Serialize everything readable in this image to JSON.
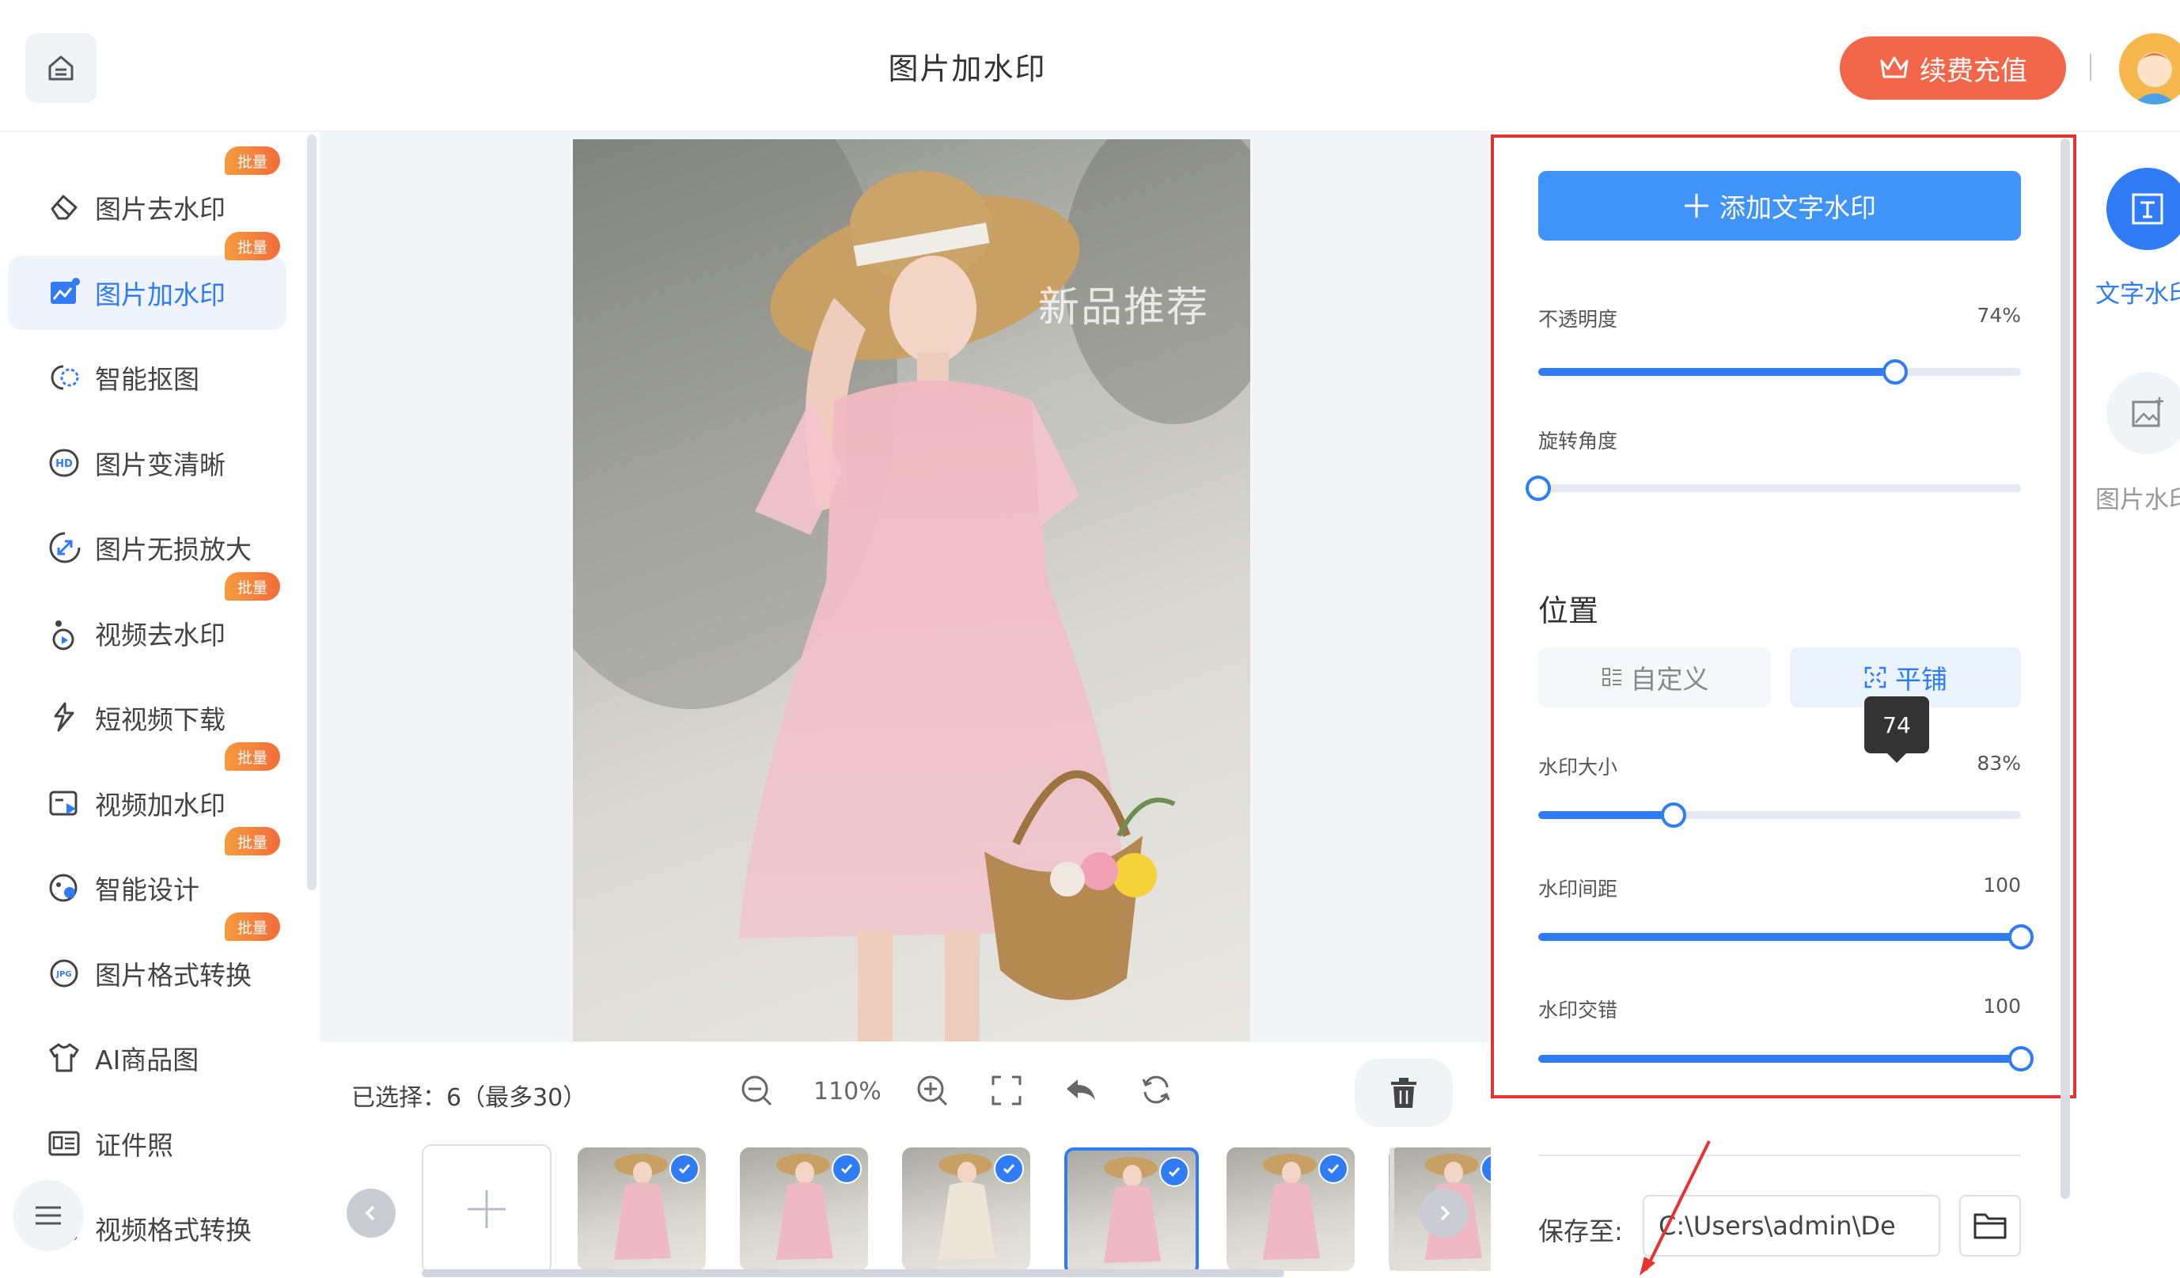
{
  "header": {
    "title": "图片加水印",
    "vip_label": "续费充值"
  },
  "sidebar": {
    "items": [
      {
        "label": "图片去水印",
        "badge": "批量",
        "icon": "eraser-icon"
      },
      {
        "label": "图片加水印",
        "badge": "批量",
        "icon": "image-watermark-icon",
        "active": true
      },
      {
        "label": "智能抠图",
        "badge": "",
        "icon": "cutout-icon"
      },
      {
        "label": "图片变清晰",
        "badge": "",
        "icon": "hd-icon"
      },
      {
        "label": "图片无损放大",
        "badge": "",
        "icon": "enlarge-icon"
      },
      {
        "label": "视频去水印",
        "badge": "批量",
        "icon": "video-clean-icon"
      },
      {
        "label": "短视频下载",
        "badge": "",
        "icon": "link-download-icon"
      },
      {
        "label": "视频加水印",
        "badge": "批量",
        "icon": "video-watermark-icon"
      },
      {
        "label": "智能设计",
        "badge": "批量",
        "icon": "design-icon"
      },
      {
        "label": "图片格式转换",
        "badge": "批量",
        "icon": "jpg-icon"
      },
      {
        "label": "AI商品图",
        "badge": "",
        "icon": "shirt-icon"
      },
      {
        "label": "证件照",
        "badge": "",
        "icon": "id-card-icon"
      },
      {
        "label": "视频格式转换",
        "badge": "",
        "icon": "video-format-icon"
      }
    ]
  },
  "canvas": {
    "watermark_text": "新品推荐"
  },
  "toolbar": {
    "selected_text": "已选择：6（最多30）",
    "zoom": "110%"
  },
  "thumbnails": {
    "count": 6,
    "selected_index": 3
  },
  "panel": {
    "add_text_button": "添加文字水印",
    "opacity": {
      "label": "不透明度",
      "value": "74%",
      "percent": 74
    },
    "rotation": {
      "label": "旋转角度",
      "value": "",
      "percent": 0
    },
    "position_title": "位置",
    "position_options": [
      {
        "label": "自定义",
        "active": false
      },
      {
        "label": "平铺",
        "active": true
      }
    ],
    "tooltip": "74",
    "size": {
      "label": "水印大小",
      "value": "83%",
      "percent": 28
    },
    "spacing": {
      "label": "水印间距",
      "value": "100",
      "percent": 100
    },
    "stagger": {
      "label": "水印交错",
      "value": "100",
      "percent": 100
    },
    "save_label": "保存至:",
    "save_path": "C:\\Users\\admin\\De"
  },
  "right_tabs": [
    {
      "label": "文字水印",
      "active": true
    },
    {
      "label": "图片水印",
      "active": false
    }
  ],
  "colors": {
    "accent": "#2f7cf6",
    "vip": "#f2674a",
    "highlight_border": "#e8322f"
  }
}
